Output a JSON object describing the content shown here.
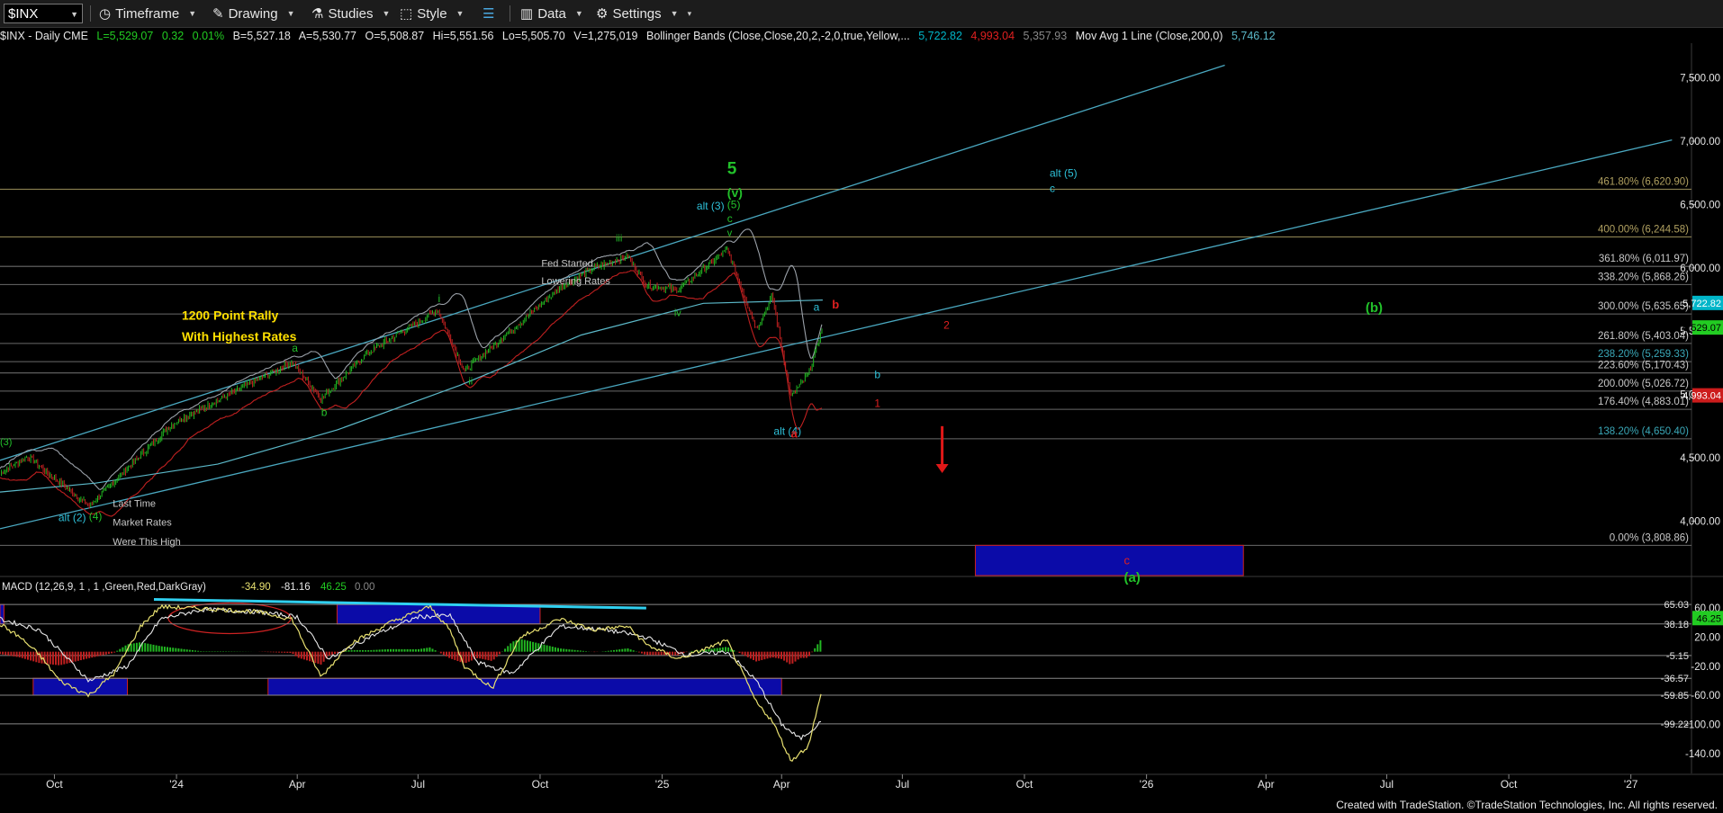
{
  "toolbar": {
    "symbol": "$INX",
    "timeframe": "Timeframe",
    "drawing": "Drawing",
    "studies": "Studies",
    "style": "Style",
    "data": "Data",
    "settings": "Settings"
  },
  "info": {
    "sym": "$INX - Daily  CME",
    "last": "L=5,529.07",
    "chg": "0.32",
    "pct": "0.01%",
    "bid": "B=5,527.18",
    "ask": "A=5,530.77",
    "open": "O=5,508.87",
    "hi": "Hi=5,551.56",
    "lo": "Lo=5,505.70",
    "vol": "V=1,275,019",
    "bb": "Bollinger Bands (Close,Close,20,2,-2,0,true,Yellow,...",
    "bb_up": "5,722.82",
    "bb_lo": "4,993.04",
    "bb_mid": "5,357.93",
    "ma": "Mov Avg 1 Line (Close,200,0)",
    "ma_val": "5,746.12"
  },
  "macd_header": {
    "label": "MACD (12,26,9, 1 , 1 ,Green,Red,DarkGray)",
    "v1": "-34.90",
    "v2": "-81.16",
    "v3": "46.25",
    "v4": "0.00"
  },
  "colors": {
    "bull": "#22b822",
    "bear": "#c02020",
    "bb": "#9aa0a8",
    "ma": "#5bb8c8",
    "channel": "#4aa8c0",
    "fib": "#777777",
    "box": "#0b0ba8",
    "boxBorder": "#cc2222",
    "macdYellow": "#e8e070",
    "macdLine": "#e8e8e8",
    "greenLabel": "#22c02a",
    "cyanLabel": "#2ec0d8",
    "redLabel": "#e02020",
    "yellowText": "#ffe000",
    "whiteText": "#c8c8c8"
  },
  "chart_data": {
    "type": "line",
    "title": "$INX - Daily",
    "x_ticks": [
      "Oct",
      "'24",
      "Apr",
      "Jul",
      "Oct",
      "'25",
      "Apr",
      "Jul",
      "Oct",
      "'26",
      "Apr",
      "Jul",
      "Oct",
      "'27"
    ],
    "price_axis": {
      "range": [
        3570,
        7760
      ],
      "ticks": [
        4000,
        4500,
        5000,
        5500,
        6000,
        6500,
        7000,
        7500
      ],
      "tick_labels": [
        "4,000.00",
        "4,500.00",
        "5,000.00",
        "5,500.00",
        "6,000.00",
        "6,500.00",
        "7,000.00",
        "7,500.00"
      ]
    },
    "price_markers": [
      {
        "value": 5722.82,
        "label": "5,722.82",
        "color": "#00b5c8"
      },
      {
        "value": 5529.07,
        "label": "5,529.07",
        "color": "#22cc22"
      },
      {
        "value": 4993.04,
        "label": "4,993.04",
        "color": "#cc1c1c"
      }
    ],
    "fib_levels": [
      {
        "value": 6620.9,
        "label": "461.80% (6,620.90)",
        "color": "#b0a060"
      },
      {
        "value": 6244.58,
        "label": "400.00% (6,244.58)",
        "color": "#b0a060"
      },
      {
        "value": 6011.97,
        "label": "361.80% (6,011.97)",
        "color": "#c8c8c8"
      },
      {
        "value": 5868.26,
        "label": "338.20% (5,868.26)",
        "color": "#c8c8c8"
      },
      {
        "value": 5635.65,
        "label": "300.00% (5,635.65)",
        "color": "#c8c8c8"
      },
      {
        "value": 5403.04,
        "label": "261.80% (5,403.04)",
        "color": "#c8c8c8"
      },
      {
        "value": 5259.33,
        "label": "238.20% (5,259.33)",
        "color": "#3aa8b8"
      },
      {
        "value": 5170.43,
        "label": "223.60% (5,170.43)",
        "color": "#c8c8c8"
      },
      {
        "value": 5026.72,
        "label": "200.00% (5,026.72)",
        "color": "#c8c8c8"
      },
      {
        "value": 4883.01,
        "label": "176.40% (4,883.01)",
        "color": "#c8c8c8"
      },
      {
        "value": 4650.4,
        "label": "138.20% (4,650.40)",
        "color": "#3aa8b8"
      },
      {
        "value": 3808.86,
        "label": "0.00% (3,808.86)",
        "color": "#c8c8c8"
      }
    ],
    "series": [
      {
        "name": "Price",
        "x": [
          "2023-08-21",
          "2023-09-11",
          "2023-10-27",
          "2023-12-29",
          "2024-03-28",
          "2024-04-19",
          "2024-05-23",
          "2024-07-16",
          "2024-08-05",
          "2024-10-16",
          "2024-11-11",
          "2024-12-06",
          "2024-12-20",
          "2025-01-13",
          "2025-02-19",
          "2025-03-13",
          "2025-03-25",
          "2025-04-08",
          "2025-04-21",
          "2025-05-02"
        ],
        "y": [
          4380,
          4510,
          4117,
          4770,
          5254,
          4967,
          5321,
          5667,
          5186,
          5842,
          6001,
          6090,
          5867,
          5827,
          6144,
          5521,
          5777,
          4982,
          5158,
          5529
        ]
      },
      {
        "name": "Mov Avg 200",
        "x": [
          "2023-08-21",
          "2023-11-01",
          "2024-02-01",
          "2024-05-01",
          "2024-08-01",
          "2024-11-01",
          "2025-02-01",
          "2025-05-02"
        ],
        "y": [
          4230,
          4300,
          4450,
          4720,
          5070,
          5470,
          5720,
          5746
        ]
      }
    ],
    "channel_lines": [
      {
        "x": [
          "2023-08-21",
          "2026-03-01"
        ],
        "y": [
          4480,
          7600
        ]
      },
      {
        "x": [
          "2023-08-21",
          "2027-02-01"
        ],
        "y": [
          3940,
          7010
        ]
      }
    ],
    "target_box": {
      "x": [
        "2025-08-25",
        "2026-03-15"
      ],
      "y": [
        3560,
        3808.86
      ]
    },
    "annotations": [
      {
        "text": "5",
        "x": "2025-02-19",
        "y": 6740,
        "color": "green",
        "size": 19,
        "bold": true
      },
      {
        "text": "(v)",
        "x": "2025-02-19",
        "y": 6560,
        "color": "green",
        "size": 14,
        "bold": true
      },
      {
        "text": "(5)",
        "x": "2025-02-19",
        "y": 6470,
        "color": "green",
        "size": 12
      },
      {
        "text": "c",
        "x": "2025-02-19",
        "y": 6360,
        "color": "green",
        "size": 12
      },
      {
        "text": "v",
        "x": "2025-02-19",
        "y": 6250,
        "color": "green",
        "size": 11
      },
      {
        "text": "alt (3)",
        "x": "2025-01-27",
        "y": 6460,
        "color": "cyan",
        "size": 12
      },
      {
        "text": "iii",
        "x": "2024-11-27",
        "y": 6210,
        "color": "green",
        "size": 11
      },
      {
        "text": "iv",
        "x": "2025-01-10",
        "y": 5620,
        "color": "green",
        "size": 11
      },
      {
        "text": "Fed Started",
        "x": "2024-10-02",
        "y": 6010,
        "color": "white",
        "size": 11
      },
      {
        "text": "Lowering Rates",
        "x": "2024-10-02",
        "y": 5870,
        "color": "white",
        "size": 11
      },
      {
        "text": "i",
        "x": "2024-07-16",
        "y": 5730,
        "color": "green",
        "size": 12
      },
      {
        "text": "ii",
        "x": "2024-08-08",
        "y": 5080,
        "color": "green",
        "size": 11
      },
      {
        "text": "a",
        "x": "2024-03-28",
        "y": 5340,
        "color": "green",
        "size": 12
      },
      {
        "text": "b",
        "x": "2024-04-19",
        "y": 4830,
        "color": "green",
        "size": 12
      },
      {
        "text": "1200 Point Rally",
        "x": "2024-01-05",
        "y": 5590,
        "color": "yellow",
        "size": 14,
        "bold": true
      },
      {
        "text": "With Highest Rates",
        "x": "2024-01-05",
        "y": 5425,
        "color": "yellow",
        "size": 14,
        "bold": true
      },
      {
        "text": "(3)",
        "x": "2023-08-21",
        "y": 4600,
        "color": "green",
        "size": 11
      },
      {
        "text": "alt (2)",
        "x": "2023-10-04",
        "y": 4000,
        "color": "cyan",
        "size": 12
      },
      {
        "text": "(4)",
        "x": "2023-10-27",
        "y": 4010,
        "color": "green",
        "size": 12
      },
      {
        "text": "Last Time",
        "x": "2023-11-14",
        "y": 4115,
        "color": "white",
        "size": 11
      },
      {
        "text": "Market Rates",
        "x": "2023-11-14",
        "y": 3965,
        "color": "white",
        "size": 11
      },
      {
        "text": "Were This High",
        "x": "2023-11-14",
        "y": 3810,
        "color": "white",
        "size": 11
      },
      {
        "text": "a",
        "x": "2025-04-25",
        "y": 5660,
        "color": "cyan",
        "size": 12
      },
      {
        "text": "b",
        "x": "2025-05-09",
        "y": 5680,
        "color": "red",
        "size": 13,
        "bold": true
      },
      {
        "text": "alt (4)",
        "x": "2025-03-26",
        "y": 4680,
        "color": "cyan",
        "size": 12
      },
      {
        "text": "a",
        "x": "2025-04-08",
        "y": 4660,
        "color": "red",
        "size": 13,
        "bold": true
      },
      {
        "text": "b",
        "x": "2025-06-10",
        "y": 5130,
        "color": "cyan",
        "size": 12
      },
      {
        "text": "2",
        "x": "2025-08-01",
        "y": 5520,
        "color": "red",
        "size": 12
      },
      {
        "text": "1",
        "x": "2025-06-10",
        "y": 4900,
        "color": "red",
        "size": 12
      },
      {
        "text": "alt (5)",
        "x": "2025-10-20",
        "y": 6720,
        "color": "cyan",
        "size": 12
      },
      {
        "text": "c",
        "x": "2025-10-20",
        "y": 6600,
        "color": "cyan",
        "size": 12
      },
      {
        "text": "(b)",
        "x": "2026-06-15",
        "y": 5650,
        "color": "green",
        "size": 15,
        "bold": true
      },
      {
        "text": "c",
        "x": "2025-12-15",
        "y": 3660,
        "color": "red",
        "size": 13
      },
      {
        "text": "(a)",
        "x": "2025-12-15",
        "y": 3520,
        "color": "green",
        "size": 15,
        "bold": true
      }
    ],
    "down_arrow": {
      "x": "2025-07-31",
      "y_from": 4750,
      "y_to": 4380
    },
    "macd": {
      "axis": {
        "range": [
          -165,
          80
        ],
        "ticks": [
          60,
          20,
          -20,
          -60,
          -100,
          -140
        ],
        "tick_labels": [
          "60.00",
          "20.00",
          "-20.00",
          "-60.00",
          "-100.00",
          "-140.00"
        ]
      },
      "levels": [
        {
          "value": 65.03,
          "label": "65.03"
        },
        {
          "value": 38.18,
          "label": "38.18"
        },
        {
          "value": -5.15,
          "label": "-5.15"
        },
        {
          "value": -36.57,
          "label": "-36.57"
        },
        {
          "value": -59.85,
          "label": "-59.85"
        },
        {
          "value": -99.22,
          "label": "-99.22"
        }
      ],
      "current": {
        "value": 46.25,
        "label": "46.25"
      },
      "macd_line": {
        "x": [
          "2023-08-21",
          "2023-09-05",
          "2023-09-20",
          "2023-10-05",
          "2023-10-27",
          "2023-11-15",
          "2023-12-05",
          "2023-12-20",
          "2024-01-10",
          "2024-02-05",
          "2024-03-01",
          "2024-03-28",
          "2024-04-19",
          "2024-05-10",
          "2024-06-10",
          "2024-07-10",
          "2024-07-25",
          "2024-08-05",
          "2024-08-26",
          "2024-09-16",
          "2024-10-16",
          "2024-11-11",
          "2024-12-06",
          "2024-12-20",
          "2025-01-13",
          "2025-02-19",
          "2025-03-13",
          "2025-03-25",
          "2025-04-08",
          "2025-04-21",
          "2025-05-02"
        ],
        "y": [
          38,
          20,
          -5,
          -40,
          -60,
          -30,
          35,
          62,
          60,
          58,
          55,
          45,
          -35,
          10,
          40,
          62,
          30,
          -20,
          -50,
          20,
          45,
          30,
          35,
          10,
          -10,
          15,
          -70,
          -95,
          -150,
          -130,
          -50
        ]
      },
      "signal_line": {
        "x": [
          "2023-08-21",
          "2023-09-20",
          "2023-10-27",
          "2023-11-25",
          "2023-12-20",
          "2024-01-20",
          "2024-03-01",
          "2024-04-01",
          "2024-04-25",
          "2024-05-25",
          "2024-07-01",
          "2024-07-25",
          "2024-08-15",
          "2024-09-10",
          "2024-10-16",
          "2024-11-20",
          "2024-12-20",
          "2025-01-20",
          "2025-02-19",
          "2025-03-13",
          "2025-04-01",
          "2025-04-15",
          "2025-05-02"
        ],
        "y": [
          45,
          30,
          -40,
          -20,
          45,
          58,
          55,
          48,
          -10,
          20,
          48,
          50,
          -15,
          -30,
          35,
          30,
          20,
          -5,
          0,
          -40,
          -100,
          -120,
          -95
        ]
      },
      "highlight_boxes": [
        {
          "x": [
            "2023-06-15",
            "2023-08-24"
          ],
          "y": [
            38.18,
            65.03
          ]
        },
        {
          "x": [
            "2024-05-01",
            "2024-10-01"
          ],
          "y": [
            38.18,
            65.03
          ]
        },
        {
          "x": [
            "2023-09-15",
            "2023-11-25"
          ],
          "y": [
            -59.85,
            -36.57
          ]
        },
        {
          "x": [
            "2024-03-10",
            "2025-04-01"
          ],
          "y": [
            -59.85,
            -36.57
          ]
        }
      ],
      "trend_line": {
        "x": [
          "2023-12-15",
          "2024-12-20"
        ],
        "y": [
          72,
          60
        ]
      }
    }
  },
  "footer": "Created with TradeStation. ©TradeStation Technologies, Inc. All rights reserved."
}
